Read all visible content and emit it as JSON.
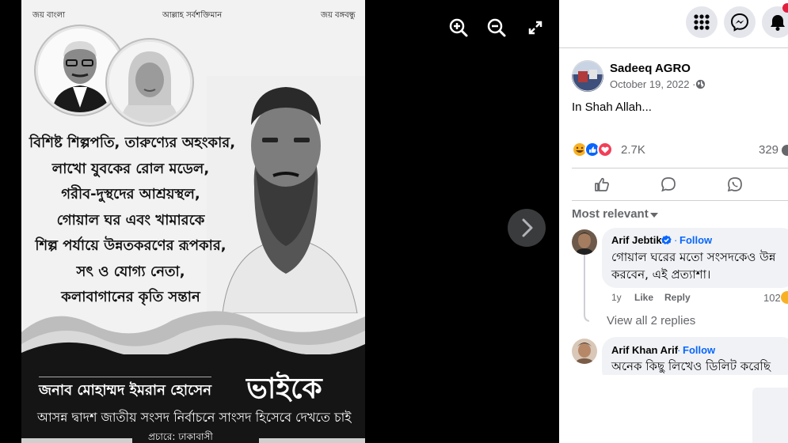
{
  "viewer": {
    "poster": {
      "top_left": "জয় বাংলা",
      "top_center": "আল্লাহ সর্বশক্তিমান",
      "top_right": "জয় বঙ্গবন্ধু",
      "lines": [
        "বিশিষ্ট শিল্পপতি, তারুণ্যের অহংকার,",
        "লাখো যুবকের রোল মডেল,",
        "গরীব-দুস্থদের আশ্রয়স্থল,",
        "গোয়াল ঘর এবং খামারকে",
        "শিল্প পর্যায়ে উন্নতকরণের রূপকার,",
        "সৎ ও যোগ্য নেতা,",
        "কলাবাগানের কৃতি সন্তান"
      ],
      "name": "জনাব মোহাম্মদ ইমরান হোসেন",
      "name_suffix": "ভাইকে",
      "slogan": "আসন্ন দ্বাদশ জাতীয় সংসদ নির্বাচনে সাংসদ হিসেবে দেখতে চাই",
      "by_line": "প্রচারে: ঢাকাবাসী"
    },
    "tools": [
      "zoom-in-icon",
      "zoom-out-icon",
      "fullscreen-icon"
    ]
  },
  "post": {
    "author": "Sadeeq AGRO",
    "date": "October 19, 2022 ·",
    "text": "In Shah Allah...",
    "reactions_count": "2.7K",
    "comments_count": "329",
    "sort_label": "Most relevant"
  },
  "comments": [
    {
      "author": "Arif Jebtik",
      "follow": "Follow",
      "text_line1": "গোয়াল ঘরের মতো সংসদকেও উন্ন",
      "text_line2": "করবেন, এই প্রত্যাশা।",
      "time": "1y",
      "like": "Like",
      "reply": "Reply",
      "likes": "102",
      "view_replies": "View all 2 replies"
    },
    {
      "author": "Arif Khan Arif",
      "follow": "Follow",
      "text_line1": "অনেক কিছু লিখেও ডিলিট করেছি"
    }
  ],
  "colors": {
    "accent": "#0866ff",
    "text_secondary": "#65676b",
    "bubble": "#f0f2f5",
    "viewer_bg": "#000000"
  }
}
